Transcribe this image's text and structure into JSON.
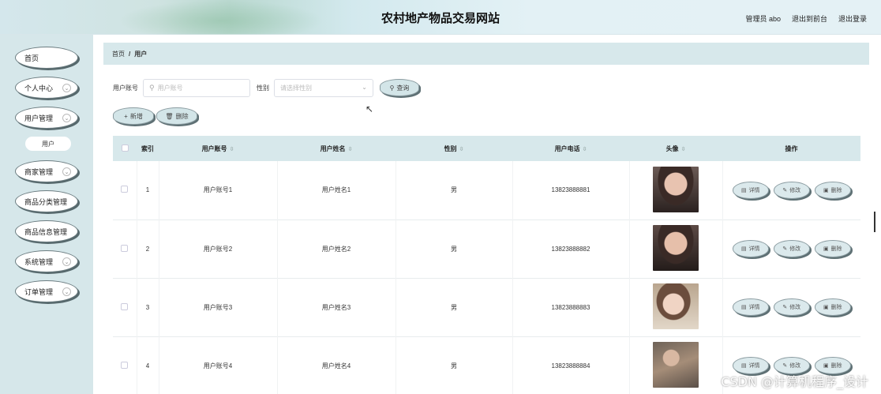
{
  "header": {
    "title": "农村地产物品交易网站",
    "admin_label": "管理员 abo",
    "back_front": "退出到前台",
    "logout": "退出登录"
  },
  "sidebar": {
    "items": [
      {
        "label": "首页",
        "has_arrow": false
      },
      {
        "label": "个人中心",
        "has_arrow": true
      },
      {
        "label": "用户管理",
        "has_arrow": true
      },
      {
        "label": "商家管理",
        "has_arrow": true
      },
      {
        "label": "商品分类管理",
        "has_arrow": false
      },
      {
        "label": "商品信息管理",
        "has_arrow": false
      },
      {
        "label": "系统管理",
        "has_arrow": true
      },
      {
        "label": "订单管理",
        "has_arrow": true
      }
    ],
    "sub_item": "用户"
  },
  "breadcrumb": {
    "home": "首页",
    "sep": "/",
    "current": "用户"
  },
  "search": {
    "account_label": "用户账号",
    "account_placeholder": "用户账号",
    "gender_label": "性别",
    "gender_placeholder": "请选择性别",
    "query_button": "查询"
  },
  "actions": {
    "add": "新增",
    "delete": "删除"
  },
  "table": {
    "headers": {
      "index": "索引",
      "account": "用户账号",
      "name": "用户姓名",
      "gender": "性别",
      "phone": "用户电话",
      "avatar": "头像",
      "ops": "操作"
    },
    "rows": [
      {
        "index": "1",
        "account": "用户账号1",
        "name": "用户姓名1",
        "gender": "男",
        "phone": "13823888881"
      },
      {
        "index": "2",
        "account": "用户账号2",
        "name": "用户姓名2",
        "gender": "男",
        "phone": "13823888882"
      },
      {
        "index": "3",
        "account": "用户账号3",
        "name": "用户姓名3",
        "gender": "男",
        "phone": "13823888883"
      },
      {
        "index": "4",
        "account": "用户账号4",
        "name": "用户姓名4",
        "gender": "男",
        "phone": "13823888884"
      }
    ],
    "row_buttons": {
      "detail": "详情",
      "edit": "修改",
      "delete": "删除"
    }
  },
  "watermark": "CSDN @计算机程序_设计",
  "colors": {
    "sidebar_bg": "#d6e7ea",
    "header_bg": "#d7e8eb",
    "button_bg": "#d3e5e8",
    "button_border": "#8a9ba0"
  }
}
